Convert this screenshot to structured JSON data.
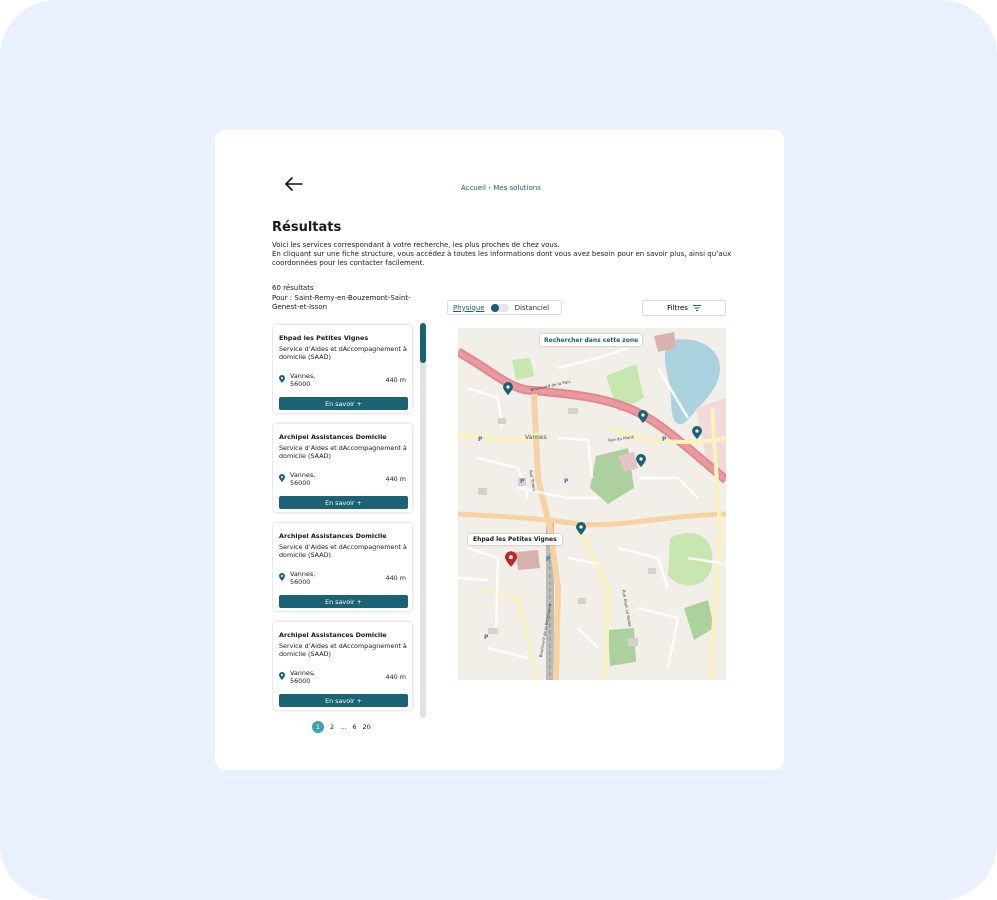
{
  "breadcrumb": "Accueil › Mes solutions",
  "page_title": "Résultats",
  "intro": {
    "line1": "Voici les services correspondant à votre recherche, les plus proches de chez vous.",
    "line2": "En cliquant sur une fiche structure, vous accédez à toutes les informations dont vous avez besoin pour en savoir plus, ainsi qu’aux coordonnées pour les contacter facilement."
  },
  "results": {
    "count": "60 résultats",
    "for_location": "Pour : Saint-Remy-en-Bouzemont-Saint-Genest-et-Isson"
  },
  "toggle": {
    "physique": "Physique",
    "distanciel": "Distanciel",
    "selected": "Physique"
  },
  "filters_label": "Filtres",
  "cards": [
    {
      "title": "Ehpad les Petites Vignes",
      "type": "Service d’Aides et dAccompagnement à domicile (SAAD)",
      "city": "Vannes, 56000",
      "distance": "440 m",
      "button": "En savoir +"
    },
    {
      "title": "Archipel Assistances Domicile",
      "type": "Service d’Aides et dAccompagnement à domicile (SAAD)",
      "city": "Vannes, 56000",
      "distance": "440 m",
      "button": "En savoir +"
    },
    {
      "title": "Archipel Assistances Domicile",
      "type": "Service d’Aides et dAccompagnement à domicile (SAAD)",
      "city": "Vannes, 56000",
      "distance": "440 m",
      "button": "En savoir +"
    },
    {
      "title": "Archipel Assistances Domicile",
      "type": "Service d’Aides et dAccompagnement à domicile (SAAD)",
      "city": "Vannes, 56000",
      "distance": "440 m",
      "button": "En savoir +"
    }
  ],
  "pagination": {
    "current": "1",
    "p2": "2",
    "ellipsis": "...",
    "p6": "6",
    "last": "20"
  },
  "map": {
    "search_zone_button": "Rechercher dans cette zone",
    "tooltip": "Ehpad les Petites Vignes",
    "city_label": "Vannes",
    "street_labels": [
      "Boulevard de la Paix",
      "Rue du Mené",
      "Rue Thiers",
      "Rue Alain Le Rallec",
      "Boulevard de la Résistance"
    ],
    "parking_label": "P"
  },
  "colors": {
    "primary": "#1a6274",
    "accent": "#3aa5ad",
    "selected_pin": "#c0262d",
    "background": "#eaf1fe"
  }
}
